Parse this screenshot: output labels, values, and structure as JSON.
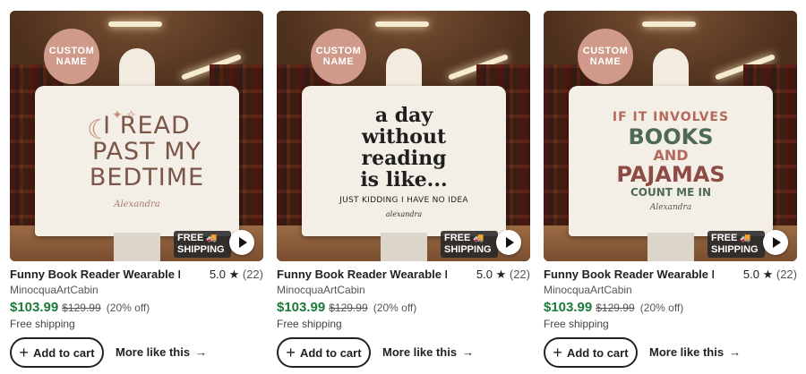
{
  "colors": {
    "price_green": "#1b7a3a",
    "badge_pink": "#cf9a8a"
  },
  "products": [
    {
      "badge": "CUSTOM NAME",
      "design_lines": [
        "I READ",
        "PAST MY",
        "BEDTIME"
      ],
      "design_signature": "Alexandra",
      "shipping_badge": [
        "FREE",
        "SHIPPING"
      ],
      "title": "Funny Book Reader Wearable Ho...",
      "rating": "5.0",
      "rating_count": "(22)",
      "shop": "MinocquaArtCabin",
      "price": "$103.99",
      "original_price": "$129.99",
      "discount": "(20% off)",
      "shipping": "Free shipping",
      "add_to_cart": "Add to cart",
      "more_like_this": "More like this"
    },
    {
      "badge": "CUSTOM NAME",
      "design_lines": [
        "a day",
        "without",
        "reading",
        "is like..."
      ],
      "design_small": "JUST KIDDING I HAVE NO IDEA",
      "design_signature": "alexandra",
      "shipping_badge": [
        "FREE",
        "SHIPPING"
      ],
      "title": "Funny Book Reader Wearable Ho...",
      "rating": "5.0",
      "rating_count": "(22)",
      "shop": "MinocquaArtCabin",
      "price": "$103.99",
      "original_price": "$129.99",
      "discount": "(20% off)",
      "shipping": "Free shipping",
      "add_to_cart": "Add to cart",
      "more_like_this": "More like this"
    },
    {
      "badge": "CUSTOM NAME",
      "design_lines": [
        "IF IT INVOLVES",
        "BOOKS",
        "AND",
        "PAJAMAS",
        "COUNT ME IN"
      ],
      "design_signature": "Alexandra",
      "shipping_badge": [
        "FREE",
        "SHIPPING"
      ],
      "title": "Funny Book Reader Wearable Ho...",
      "rating": "5.0",
      "rating_count": "(22)",
      "shop": "MinocquaArtCabin",
      "price": "$103.99",
      "original_price": "$129.99",
      "discount": "(20% off)",
      "shipping": "Free shipping",
      "add_to_cart": "Add to cart",
      "more_like_this": "More like this"
    }
  ]
}
